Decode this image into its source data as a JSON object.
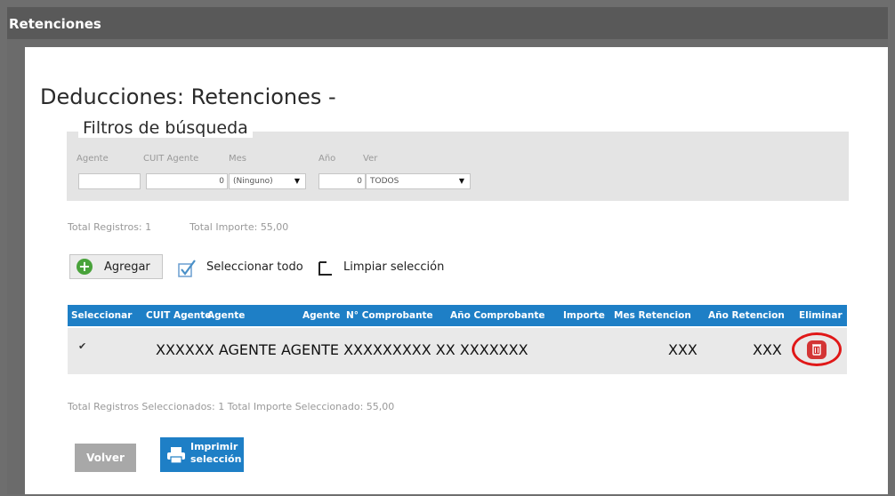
{
  "window": {
    "title": "Retenciones"
  },
  "page": {
    "title": "Deducciones: Retenciones -"
  },
  "filters": {
    "title": "Filtros de búsqueda",
    "agente": {
      "label": "Agente",
      "value": ""
    },
    "cuit_agente": {
      "label": "CUIT Agente",
      "value": "0"
    },
    "mes": {
      "label": "Mes",
      "value": "(Ninguno)"
    },
    "anio": {
      "label": "Año",
      "value": "0"
    },
    "ver": {
      "label": "Ver",
      "value": "TODOS"
    }
  },
  "stats": {
    "total_registros_label": "Total Registros:",
    "total_registros_value": "1",
    "total_importe_label": "Total Importe:",
    "total_importe_value": "55,00"
  },
  "toolbar": {
    "add_label": "Agregar",
    "select_all_label": "Seleccionar todo",
    "clear_selection_label": "Limpiar selección"
  },
  "table": {
    "columns": [
      "Seleccionar",
      "CUIT Agente",
      "Agente",
      "Agente",
      "N° Comprobante",
      "Año Comprobante",
      "Importe",
      "Mes Retencion",
      "Año Retencion",
      "Eliminar"
    ],
    "rows": [
      {
        "selected": "✔",
        "content": "XXXXXX AGENTE AGENTE XXXXXXXXX XX XXXXXXX",
        "mes_retencion": "XXX",
        "anio_retencion": "XXX"
      }
    ]
  },
  "selection": {
    "summary": "Total Registros Seleccionados:  1 Total Importe Seleccionado:  55,00"
  },
  "actions": {
    "back_label": "Volver",
    "print_line1": "Imprimir",
    "print_line2": "selección"
  },
  "colors": {
    "header_blue": "#1e7fc6",
    "add_green": "#48a23a",
    "delete_red": "#d33535",
    "highlight_ring": "#e01818"
  }
}
